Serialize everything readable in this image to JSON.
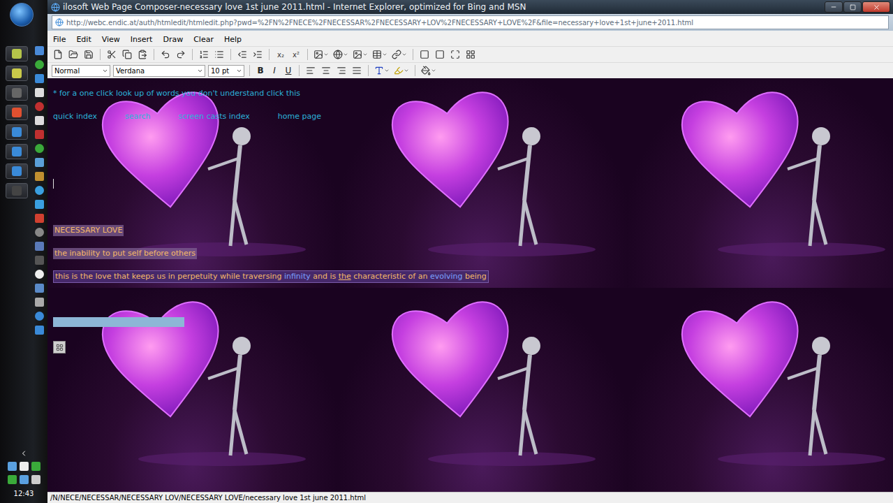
{
  "window": {
    "title": "ilosoft Web Page Composer-necessary love 1st june 2011.html - Internet Explorer, optimized for Bing and MSN",
    "address": "http://webc.endic.at/auth/htmledit/htmledit.php?pwd=%2FN%2FNECE%2FNECESSAR%2FNECESSARY+LOV%2FNECESSARY+LOVE%2F&file=necessary+love+1st+june+2011.html"
  },
  "menu": [
    "File",
    "Edit",
    "View",
    "Insert",
    "Draw",
    "Clear",
    "Help"
  ],
  "toolbar": {
    "subscript": "x₂",
    "superscript": "x²"
  },
  "format_bar": {
    "style": "Normal",
    "font": "Verdana",
    "size": "10 pt",
    "bold": "B",
    "italic": "I",
    "underline": "U"
  },
  "page": {
    "lookup_line": "* for a one click look up of words you don't understand click this",
    "nav_links": [
      "quick index",
      "search",
      "screen casts index",
      "home page"
    ],
    "heading": "NECESSARY LOVE",
    "definition": "the inability to put self before others",
    "sentence": [
      {
        "text": "this is the love that keeps us in perpetuity while traversing ",
        "kind": "plain"
      },
      {
        "text": "infinity",
        "kind": "link"
      },
      {
        "text": " and is ",
        "kind": "plain"
      },
      {
        "text": "the",
        "kind": "underline"
      },
      {
        "text": " characteristic of an ",
        "kind": "plain"
      },
      {
        "text": "evolving",
        "kind": "link"
      },
      {
        "text": " being",
        "kind": "plain"
      }
    ]
  },
  "status_bar": "/N/NECE/NECESSAR/NECESSARY LOV/NECESSARY LOVE/necessary love 1st june 2011.html",
  "taskbar": {
    "clock": "12:43"
  }
}
